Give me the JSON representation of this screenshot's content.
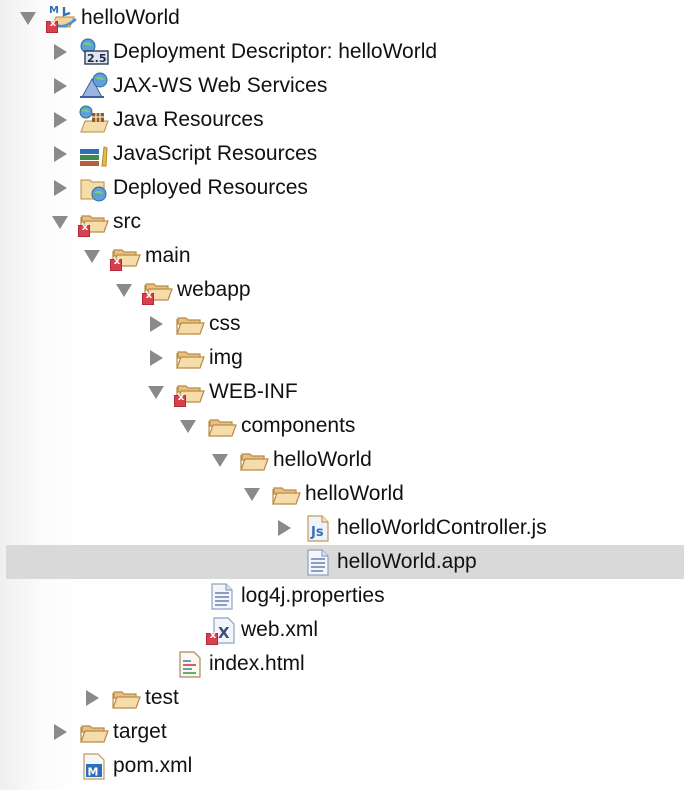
{
  "tree": [
    {
      "label": "helloWorld",
      "depth": 0,
      "state": "expanded",
      "icon": "maven-web-project-icon",
      "error": true
    },
    {
      "label": "Deployment Descriptor: helloWorld",
      "depth": 1,
      "state": "collapsed",
      "icon": "deployment-descriptor-icon",
      "error": false
    },
    {
      "label": "JAX-WS Web Services",
      "depth": 1,
      "state": "collapsed",
      "icon": "web-services-icon",
      "error": false
    },
    {
      "label": "Java Resources",
      "depth": 1,
      "state": "collapsed",
      "icon": "java-resources-icon",
      "error": false
    },
    {
      "label": "JavaScript Resources",
      "depth": 1,
      "state": "collapsed",
      "icon": "javascript-resources-icon",
      "error": false
    },
    {
      "label": "Deployed Resources",
      "depth": 1,
      "state": "collapsed",
      "icon": "deployed-resources-icon",
      "error": false
    },
    {
      "label": "src",
      "depth": 1,
      "state": "expanded",
      "icon": "folder-icon",
      "error": true
    },
    {
      "label": "main",
      "depth": 2,
      "state": "expanded",
      "icon": "folder-icon",
      "error": true
    },
    {
      "label": "webapp",
      "depth": 3,
      "state": "expanded",
      "icon": "folder-icon",
      "error": true
    },
    {
      "label": "css",
      "depth": 4,
      "state": "collapsed",
      "icon": "folder-icon",
      "error": false
    },
    {
      "label": "img",
      "depth": 4,
      "state": "collapsed",
      "icon": "folder-icon",
      "error": false
    },
    {
      "label": "WEB-INF",
      "depth": 4,
      "state": "expanded",
      "icon": "folder-icon",
      "error": true
    },
    {
      "label": "components",
      "depth": 5,
      "state": "expanded",
      "icon": "folder-icon",
      "error": false
    },
    {
      "label": "helloWorld",
      "depth": 6,
      "state": "expanded",
      "icon": "folder-icon",
      "error": false
    },
    {
      "label": "helloWorld",
      "depth": 7,
      "state": "expanded",
      "icon": "folder-icon",
      "error": false
    },
    {
      "label": "helloWorldController.js",
      "depth": 8,
      "state": "collapsed",
      "icon": "javascript-file-icon",
      "error": false
    },
    {
      "label": "helloWorld.app",
      "depth": 8,
      "state": "leaf",
      "icon": "text-file-icon",
      "error": false,
      "selected": true
    },
    {
      "label": "log4j.properties",
      "depth": 5,
      "state": "leaf",
      "icon": "text-file-icon",
      "error": false
    },
    {
      "label": "web.xml",
      "depth": 5,
      "state": "leaf",
      "icon": "xml-file-icon",
      "error": true
    },
    {
      "label": "index.html",
      "depth": 4,
      "state": "leaf",
      "icon": "html-file-icon",
      "error": false
    },
    {
      "label": "test",
      "depth": 2,
      "state": "collapsed",
      "icon": "folder-icon",
      "error": false
    },
    {
      "label": "target",
      "depth": 1,
      "state": "collapsed",
      "icon": "folder-icon",
      "error": false
    },
    {
      "label": "pom.xml",
      "depth": 1,
      "state": "leaf",
      "icon": "maven-pom-icon",
      "error": false
    }
  ],
  "colors": {
    "selection": "#d9d9d9",
    "error_badge": "#d9404e",
    "twisty": "#8a8a8a",
    "folder": "#f3d39a"
  }
}
